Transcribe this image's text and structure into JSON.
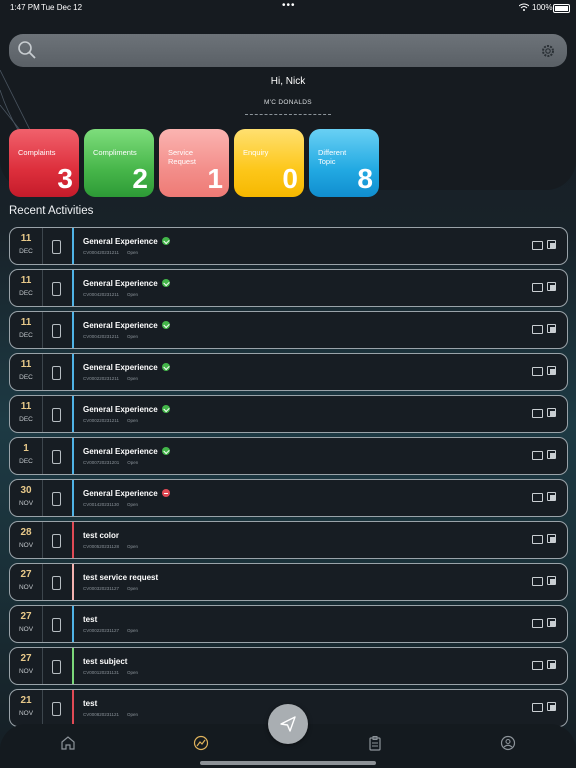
{
  "status_bar": {
    "time": "1:47 PM",
    "date": "Tue Dec 12",
    "battery": "100%"
  },
  "search": {
    "placeholder": ""
  },
  "greeting": "Hi, Nick",
  "company": "M'C DONALDS",
  "categories": [
    {
      "label": "Complaints",
      "count": "3",
      "color": "#dd2f3c"
    },
    {
      "label": "Compliments",
      "count": "2",
      "color": "#47b64a"
    },
    {
      "label": "Service Request",
      "count": "1",
      "color": "#f38e8a"
    },
    {
      "label": "Enquiry",
      "count": "0",
      "color": "#fdc71a"
    },
    {
      "label": "Different Topic",
      "count": "8",
      "color": "#22a9e2"
    }
  ],
  "recent": {
    "title": "Recent Activities",
    "items": [
      {
        "day": "11",
        "month": "DEC",
        "title": "General Experience",
        "ref": "CV000420231211",
        "status": "Open",
        "bar": "#4fb3e6",
        "badge": "#43b649"
      },
      {
        "day": "11",
        "month": "DEC",
        "title": "General Experience",
        "ref": "CV000420231211",
        "status": "Open",
        "bar": "#4fb3e6",
        "badge": "#43b649"
      },
      {
        "day": "11",
        "month": "DEC",
        "title": "General Experience",
        "ref": "CV000420231211",
        "status": "Open",
        "bar": "#4fb3e6",
        "badge": "#43b649"
      },
      {
        "day": "11",
        "month": "DEC",
        "title": "General Experience",
        "ref": "CV000220231211",
        "status": "Open",
        "bar": "#4fb3e6",
        "badge": "#43b649"
      },
      {
        "day": "11",
        "month": "DEC",
        "title": "General Experience",
        "ref": "CV000220231211",
        "status": "Open",
        "bar": "#4fb3e6",
        "badge": "#43b649"
      },
      {
        "day": "1",
        "month": "DEC",
        "title": "General Experience",
        "ref": "CV000720231201",
        "status": "Open",
        "bar": "#4fb3e6",
        "badge": "#43b649"
      },
      {
        "day": "30",
        "month": "NOV",
        "title": "General Experience",
        "ref": "CV001420231130",
        "status": "Open",
        "bar": "#4fb3e6",
        "badge": "#e04a55"
      },
      {
        "day": "28",
        "month": "NOV",
        "title": "test color",
        "ref": "CV000520231128",
        "status": "Open",
        "bar": "#e04a55",
        "badge": ""
      },
      {
        "day": "27",
        "month": "NOV",
        "title": "test service request",
        "ref": "CV000320231127",
        "status": "Open",
        "bar": "#f4b3b0",
        "badge": ""
      },
      {
        "day": "27",
        "month": "NOV",
        "title": "test",
        "ref": "CV000220231127",
        "status": "Open",
        "bar": "#4fb3e6",
        "badge": ""
      },
      {
        "day": "27",
        "month": "NOV",
        "title": "test subject",
        "ref": "CV000120231131",
        "status": "Open",
        "bar": "#7bd77a",
        "badge": ""
      },
      {
        "day": "21",
        "month": "NOV",
        "title": "test",
        "ref": "CV000820231121",
        "status": "Open",
        "bar": "#e04a55",
        "badge": ""
      }
    ]
  },
  "icons": {
    "search": "search-icon",
    "settings": "gear-icon",
    "home": "home-icon",
    "dashboard": "dashboard-icon",
    "clipboard": "clipboard-icon",
    "profile": "profile-icon",
    "send": "send-icon"
  }
}
